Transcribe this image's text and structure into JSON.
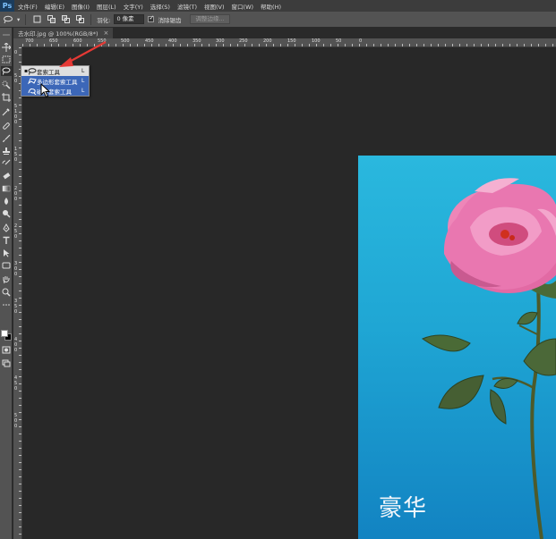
{
  "app": {
    "logo": "Ps"
  },
  "menu": [
    "文件(F)",
    "编辑(E)",
    "图像(I)",
    "图层(L)",
    "文字(Y)",
    "选择(S)",
    "滤镜(T)",
    "视图(V)",
    "窗口(W)",
    "帮助(H)"
  ],
  "options": {
    "feather_label": "羽化:",
    "feather_value": "0 像素",
    "antialias_label": "消除锯齿",
    "refine_edge_label": "调整边缘..."
  },
  "document": {
    "tab_title": "去水印.jpg @ 100%(RGB/8*)",
    "close_glyph": "×"
  },
  "ruler": {
    "h_labels": [
      "700",
      "650",
      "600",
      "550",
      "500",
      "450",
      "400",
      "350",
      "300",
      "250",
      "200",
      "150",
      "100",
      "50",
      "0"
    ],
    "v_labels": [
      "0",
      "5",
      "0",
      "5",
      "1",
      "0",
      "0",
      "1",
      "5",
      "0",
      "2",
      "0",
      "0",
      "2",
      "5",
      "0",
      "3",
      "0",
      "0",
      "3",
      "5",
      "0",
      "4",
      "0",
      "0",
      "4",
      "5",
      "0",
      "5",
      "0",
      "0"
    ]
  },
  "flyout": {
    "items": [
      {
        "label": "套索工具",
        "shortcut": "L",
        "icon": "lasso-icon",
        "current": true
      },
      {
        "label": "多边形套索工具",
        "shortcut": "L",
        "icon": "polygonal-lasso-icon",
        "current": false
      },
      {
        "label": "磁性套索工具",
        "shortcut": "L",
        "icon": "magnetic-lasso-icon",
        "current": false
      }
    ],
    "current_bullet": "▪"
  },
  "image": {
    "caption": "豪华"
  },
  "colors": {
    "arrow": "#e53935",
    "selection": "#3c67b8",
    "photo_top": "#2ab8de",
    "photo_bottom": "#1283c2"
  }
}
